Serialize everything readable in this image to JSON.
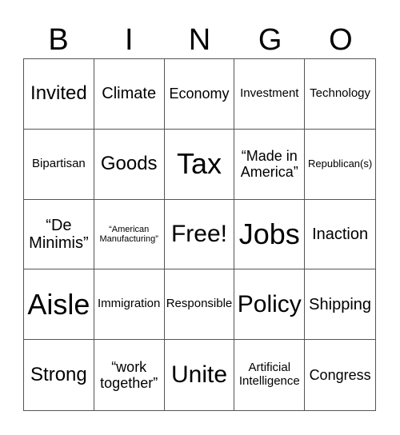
{
  "header": [
    "B",
    "I",
    "N",
    "G",
    "O"
  ],
  "cells": [
    {
      "text": "Invited",
      "size": "s-ml"
    },
    {
      "text": "Climate",
      "size": "s-m"
    },
    {
      "text": "Economy",
      "size": "s-s"
    },
    {
      "text": "Investment",
      "size": "s-xxs"
    },
    {
      "text": "Technology",
      "size": "s-xxs"
    },
    {
      "text": "Bipartisan",
      "size": "s-xxs"
    },
    {
      "text": "Goods",
      "size": "s-ml"
    },
    {
      "text": "Tax",
      "size": "s-xl"
    },
    {
      "text": "“Made in America”",
      "size": "s-s"
    },
    {
      "text": "Republican(s)",
      "size": "s-t"
    },
    {
      "text": "“De Minimis”",
      "size": "s-m"
    },
    {
      "text": "“American Manufacturing”",
      "size": "s-tt"
    },
    {
      "text": "Free!",
      "size": "s-l"
    },
    {
      "text": "Jobs",
      "size": "s-xl"
    },
    {
      "text": "Inaction",
      "size": "s-m"
    },
    {
      "text": "Aisle",
      "size": "s-xl"
    },
    {
      "text": "Immigration",
      "size": "s-xxs"
    },
    {
      "text": "Responsible",
      "size": "s-xxs"
    },
    {
      "text": "Policy",
      "size": "s-l"
    },
    {
      "text": "Shipping",
      "size": "s-m"
    },
    {
      "text": "Strong",
      "size": "s-ml"
    },
    {
      "text": "“work together”",
      "size": "s-s"
    },
    {
      "text": "Unite",
      "size": "s-l"
    },
    {
      "text": "Artificial Intelligence",
      "size": "s-xxs"
    },
    {
      "text": "Congress",
      "size": "s-s"
    }
  ]
}
